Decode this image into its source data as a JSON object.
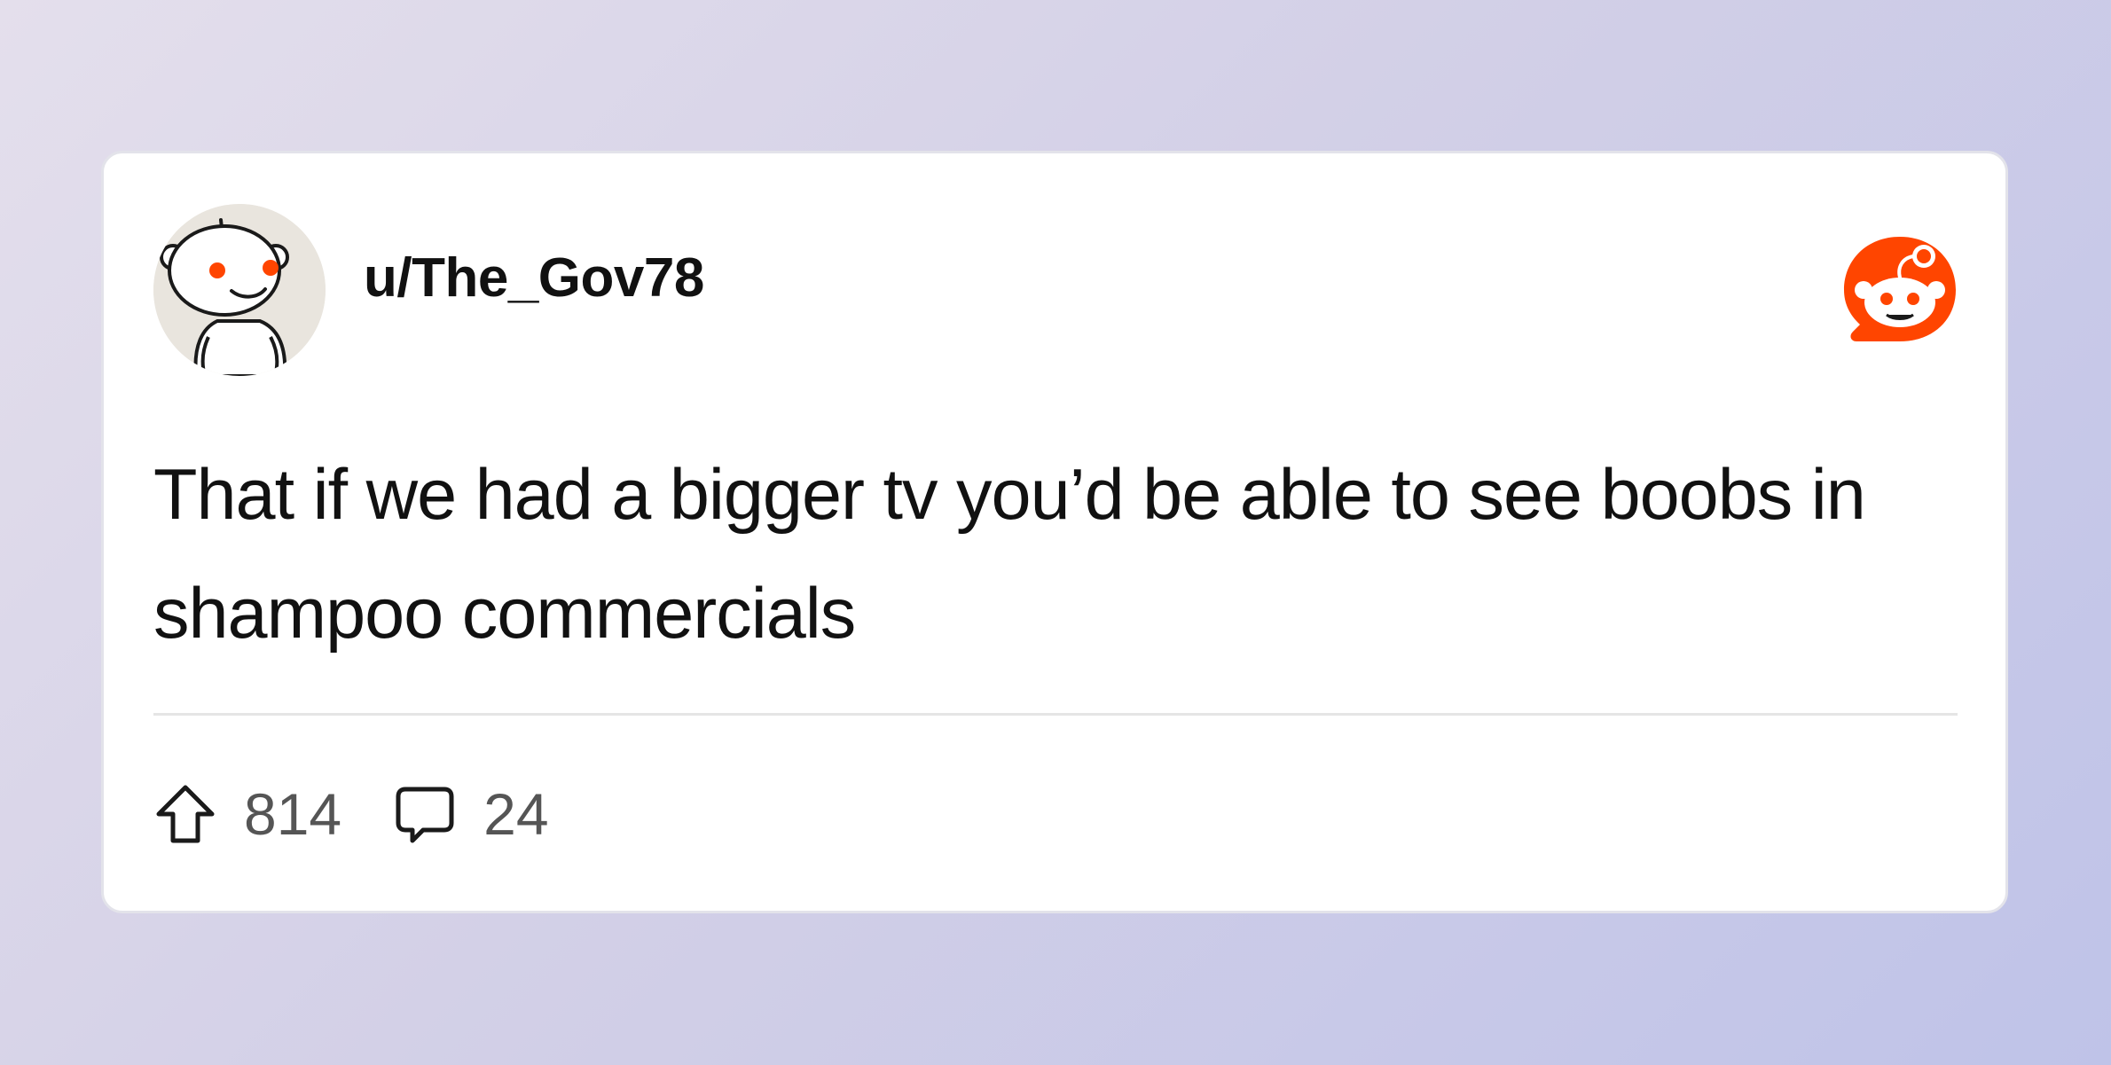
{
  "post": {
    "username": "u/The_Gov78",
    "body": "That if we had a bigger tv you’d be able to see boobs in shampoo commercials"
  },
  "stats": {
    "upvotes": "814",
    "comments": "24"
  },
  "icons": {
    "avatar": "reddit-snoo-avatar",
    "brand": "reddit-logo",
    "upvote": "upvote-arrow-icon",
    "comment": "comment-bubble-icon"
  },
  "colors": {
    "brand_orange": "#ff4500",
    "card_background": "#ffffff",
    "text_primary": "#111111",
    "text_secondary": "#555555"
  }
}
